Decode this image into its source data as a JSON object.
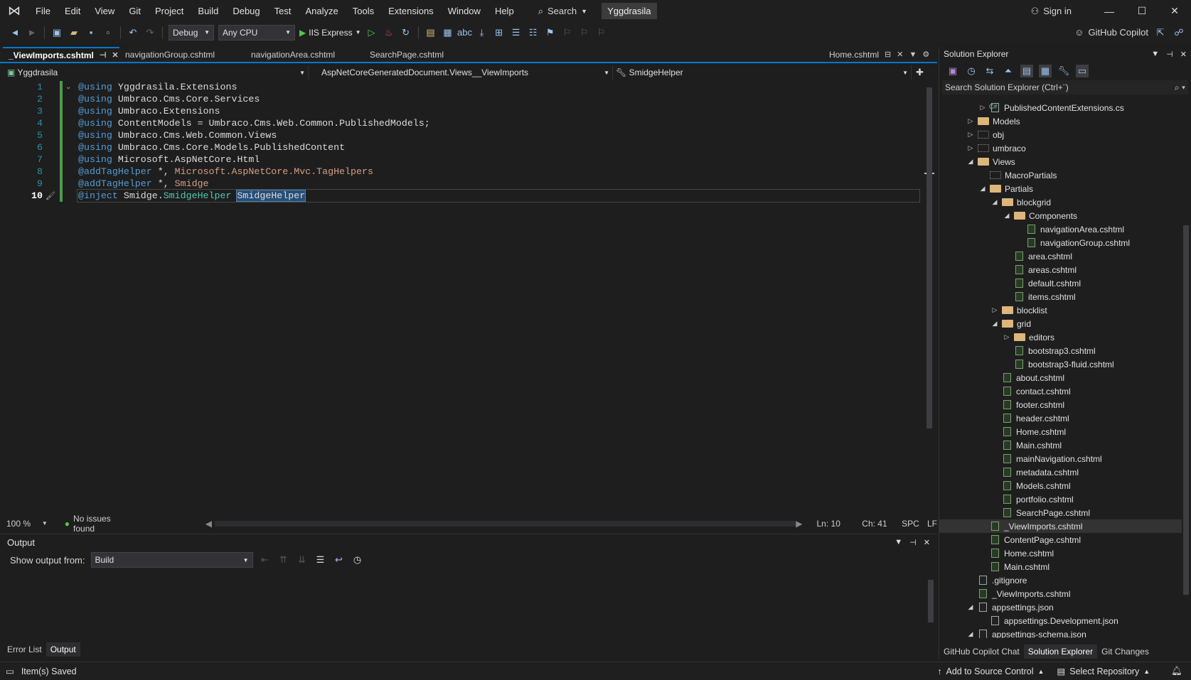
{
  "menubar": {
    "items": [
      "File",
      "Edit",
      "View",
      "Git",
      "Project",
      "Build",
      "Debug",
      "Test",
      "Analyze",
      "Tools",
      "Extensions",
      "Window",
      "Help"
    ],
    "search_label": "Search",
    "solution_name": "Yggdrasila",
    "signin_label": "Sign in"
  },
  "toolbar": {
    "config": "Debug",
    "platform": "Any CPU",
    "run_target": "IIS Express",
    "copilot_label": "GitHub Copilot"
  },
  "tabs": [
    {
      "label": "_ViewImports.cshtml"
    },
    {
      "label": "navigationGroup.cshtml"
    },
    {
      "label": "navigationArea.cshtml"
    },
    {
      "label": "SearchPage.cshtml"
    },
    {
      "label": "Home.cshtml"
    }
  ],
  "navbar": {
    "project": "Yggdrasila",
    "type": "AspNetCoreGeneratedDocument.Views__ViewImports",
    "member": "SmidgeHelper"
  },
  "editor": {
    "line_numbers": [
      "1",
      "2",
      "3",
      "4",
      "5",
      "6",
      "7",
      "8",
      "9",
      "10"
    ],
    "lines": [
      [
        "@using",
        " Yggdrasila.Extensions"
      ],
      [
        "@using",
        " Umbraco.Cms.Core.Services"
      ],
      [
        "@using",
        " Umbraco.Extensions"
      ],
      [
        "@using",
        " ContentModels = Umbraco.Cms.Web.Common.PublishedModels;"
      ],
      [
        "@using",
        " Umbraco.Cms.Web.Common.Views"
      ],
      [
        "@using",
        " Umbraco.Cms.Core.Models.PublishedContent"
      ],
      [
        "@using",
        " Microsoft.AspNetCore.Html"
      ],
      [
        "@addTagHelper",
        " *, ",
        "Microsoft.AspNetCore.Mvc.TagHelpers"
      ],
      [
        "@addTagHelper",
        " *, ",
        "Smidge"
      ],
      [
        "@inject",
        " Smidge.",
        "SmidgeHelper",
        " ",
        "SmidgeHelper"
      ]
    ]
  },
  "editor_status": {
    "zoom": "100 %",
    "issues": "No issues found",
    "line": "Ln: 10",
    "col": "Ch: 41",
    "whitespace": "SPC",
    "eol": "LF"
  },
  "output": {
    "title": "Output",
    "show_from_label": "Show output from:",
    "source": "Build"
  },
  "bottom_tabs": [
    "Error List",
    "Output"
  ],
  "statusbar": {
    "message": "Item(s) Saved",
    "source_control": "Add to Source Control",
    "repository": "Select Repository"
  },
  "solution_explorer": {
    "title": "Solution Explorer",
    "search_placeholder": "Search Solution Explorer (Ctrl+¨)",
    "nodes": [
      {
        "label": "PublishedContentExtensions.cs",
        "depth": 2,
        "kind": "cs",
        "exp": "closed"
      },
      {
        "label": "Models",
        "depth": 1,
        "kind": "folder",
        "exp": "closed"
      },
      {
        "label": "obj",
        "depth": 1,
        "kind": "dotfolder",
        "exp": "closed"
      },
      {
        "label": "umbraco",
        "depth": 1,
        "kind": "dotfolder",
        "exp": "closed"
      },
      {
        "label": "Views",
        "depth": 1,
        "kind": "folder",
        "exp": "open"
      },
      {
        "label": "MacroPartials",
        "depth": 2,
        "kind": "dotfolder",
        "exp": ""
      },
      {
        "label": "Partials",
        "depth": 2,
        "kind": "folder",
        "exp": "open"
      },
      {
        "label": "blockgrid",
        "depth": 3,
        "kind": "folder",
        "exp": "open"
      },
      {
        "label": "Components",
        "depth": 4,
        "kind": "folder",
        "exp": "open"
      },
      {
        "label": "navigationArea.cshtml",
        "depth": 5,
        "kind": "razor",
        "exp": ""
      },
      {
        "label": "navigationGroup.cshtml",
        "depth": 5,
        "kind": "razor",
        "exp": ""
      },
      {
        "label": "area.cshtml",
        "depth": 4,
        "kind": "razor",
        "exp": ""
      },
      {
        "label": "areas.cshtml",
        "depth": 4,
        "kind": "razor",
        "exp": ""
      },
      {
        "label": "default.cshtml",
        "depth": 4,
        "kind": "razor",
        "exp": ""
      },
      {
        "label": "items.cshtml",
        "depth": 4,
        "kind": "razor",
        "exp": ""
      },
      {
        "label": "blocklist",
        "depth": 3,
        "kind": "folder",
        "exp": "closed"
      },
      {
        "label": "grid",
        "depth": 3,
        "kind": "folder",
        "exp": "open"
      },
      {
        "label": "editors",
        "depth": 4,
        "kind": "folder",
        "exp": "closed"
      },
      {
        "label": "bootstrap3.cshtml",
        "depth": 4,
        "kind": "razor",
        "exp": ""
      },
      {
        "label": "bootstrap3-fluid.cshtml",
        "depth": 4,
        "kind": "razor",
        "exp": ""
      },
      {
        "label": "about.cshtml",
        "depth": 3,
        "kind": "razor",
        "exp": ""
      },
      {
        "label": "contact.cshtml",
        "depth": 3,
        "kind": "razor",
        "exp": ""
      },
      {
        "label": "footer.cshtml",
        "depth": 3,
        "kind": "razor",
        "exp": ""
      },
      {
        "label": "header.cshtml",
        "depth": 3,
        "kind": "razor",
        "exp": ""
      },
      {
        "label": "Home.cshtml",
        "depth": 3,
        "kind": "razor",
        "exp": ""
      },
      {
        "label": "Main.cshtml",
        "depth": 3,
        "kind": "razor",
        "exp": ""
      },
      {
        "label": "mainNavigation.cshtml",
        "depth": 3,
        "kind": "razor",
        "exp": ""
      },
      {
        "label": "metadata.cshtml",
        "depth": 3,
        "kind": "razor",
        "exp": ""
      },
      {
        "label": "Models.cshtml",
        "depth": 3,
        "kind": "razor",
        "exp": ""
      },
      {
        "label": "portfolio.cshtml",
        "depth": 3,
        "kind": "razor",
        "exp": ""
      },
      {
        "label": "SearchPage.cshtml",
        "depth": 3,
        "kind": "razor",
        "exp": ""
      },
      {
        "label": "_ViewImports.cshtml",
        "depth": 2,
        "kind": "razor",
        "exp": "",
        "selected": true
      },
      {
        "label": "ContentPage.cshtml",
        "depth": 2,
        "kind": "razor",
        "exp": ""
      },
      {
        "label": "Home.cshtml",
        "depth": 2,
        "kind": "razor",
        "exp": ""
      },
      {
        "label": "Main.cshtml",
        "depth": 2,
        "kind": "razor",
        "exp": ""
      },
      {
        "label": ".gitignore",
        "depth": 1,
        "kind": "file",
        "exp": ""
      },
      {
        "label": "_ViewImports.cshtml",
        "depth": 1,
        "kind": "razor",
        "exp": ""
      },
      {
        "label": "appsettings.json",
        "depth": 1,
        "kind": "json",
        "exp": "open"
      },
      {
        "label": "appsettings.Development.json",
        "depth": 2,
        "kind": "json",
        "exp": ""
      },
      {
        "label": "appsettings-schema.json",
        "depth": 1,
        "kind": "json",
        "exp": "open"
      }
    ],
    "bottom_tabs": [
      "GitHub Copilot Chat",
      "Solution Explorer",
      "Git Changes"
    ]
  }
}
